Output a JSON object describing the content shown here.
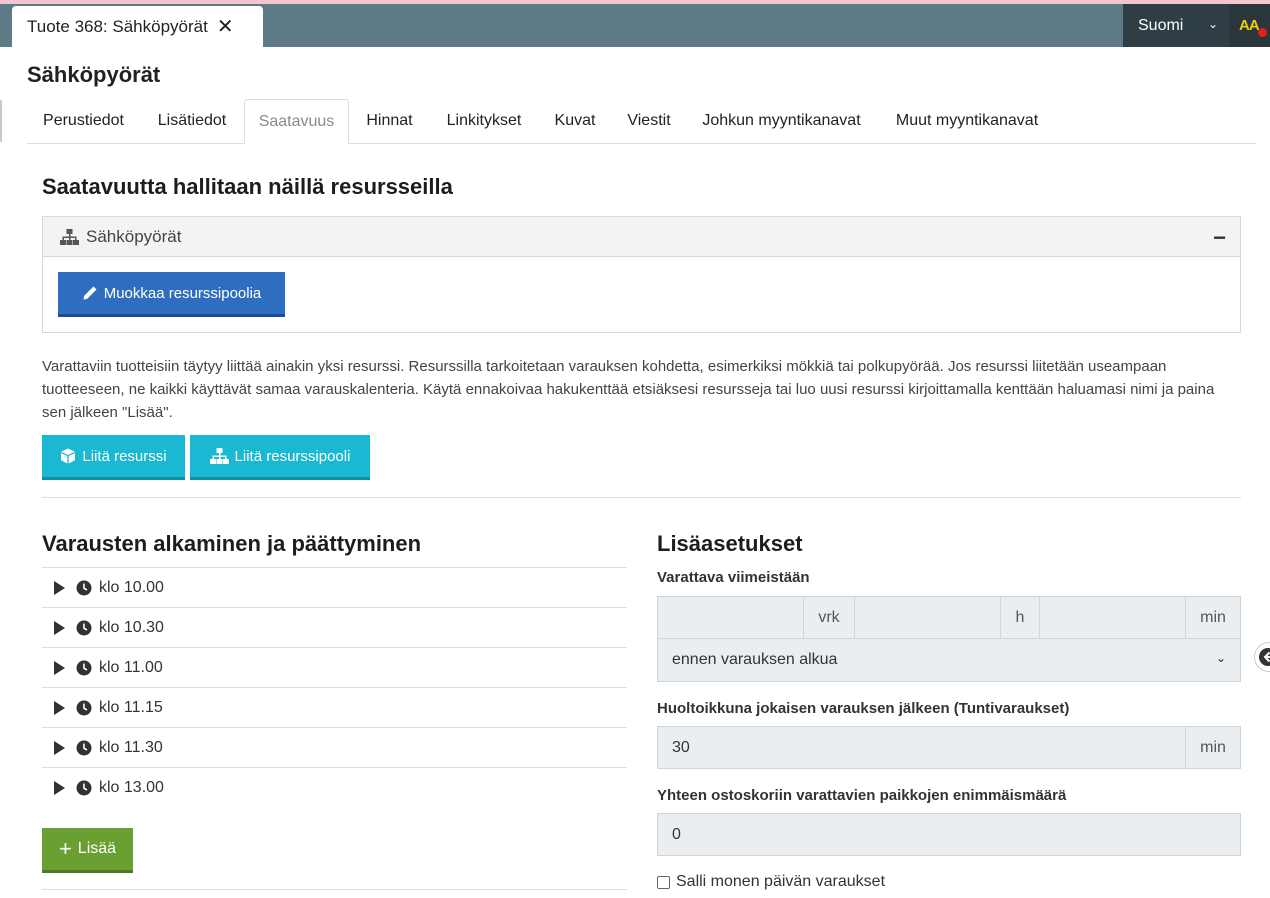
{
  "window": {
    "tab_title": "Tuote 368: Sähköpyörät",
    "close_symbol": "✕",
    "language": "Suomi",
    "accessibility_label": "AA"
  },
  "page": {
    "title": "Sähköpyörät"
  },
  "tabs": [
    {
      "label": "Perustiedot",
      "active": false
    },
    {
      "label": "Lisätiedot",
      "active": false
    },
    {
      "label": "Saatavuus",
      "active": true
    },
    {
      "label": "Hinnat",
      "active": false
    },
    {
      "label": "Linkitykset",
      "active": false
    },
    {
      "label": "Kuvat",
      "active": false
    },
    {
      "label": "Viestit",
      "active": false
    },
    {
      "label": "Johkun myyntikanavat",
      "active": false
    },
    {
      "label": "Muut myyntikanavat",
      "active": false
    }
  ],
  "resources": {
    "heading": "Saatavuutta hallitaan näillä resursseilla",
    "panel_title": "Sähköpyörät",
    "edit_pool_button": "Muokkaa resurssipoolia",
    "description": "Varattaviin tuotteisiin täytyy liittää ainakin yksi resurssi. Resurssilla tarkoitetaan varauksen kohdetta, esimerkiksi mökkiä tai polkupyörää. Jos resurssi liitetään useampaan tuotteeseen, ne kaikki käyttävät samaa varauskalenteria. Käytä ennakoivaa hakukenttää etsiäksesi resursseja tai luo uusi resurssi kirjoittamalla kenttään haluamasi nimi ja paina sen jälkeen \"Lisää\".",
    "attach_resource_button": "Liitä resurssi",
    "attach_pool_button": "Liitä resurssipooli"
  },
  "times": {
    "heading": "Varausten alkaminen ja päättyminen",
    "items": [
      "klo 10.00",
      "klo 10.30",
      "klo 11.00",
      "klo 11.15",
      "klo 11.30",
      "klo 13.00"
    ],
    "add_button": "Lisää"
  },
  "settings": {
    "heading": "Lisäasetukset",
    "latest_label": "Varattava viimeistään",
    "days_value": "",
    "days_unit": "vrk",
    "hours_value": "",
    "hours_unit": "h",
    "minutes_value": "",
    "minutes_unit": "min",
    "relative_select": "ennen varauksen alkua",
    "maintenance_label": "Huoltoikkuna jokaisen varauksen jälkeen (Tuntivaraukset)",
    "maintenance_value": "30",
    "maintenance_unit": "min",
    "max_spots_label": "Yhteen ostoskoriin varattavien paikkojen enimmäismäärä",
    "max_spots_value": "0",
    "multi_day_label": "Salli monen päivän varaukset"
  },
  "colors": {
    "topbar": "#5e7a87",
    "primary_button": "#2e6dbf",
    "info_button": "#1bb8d3",
    "success_button": "#6a9f32"
  }
}
